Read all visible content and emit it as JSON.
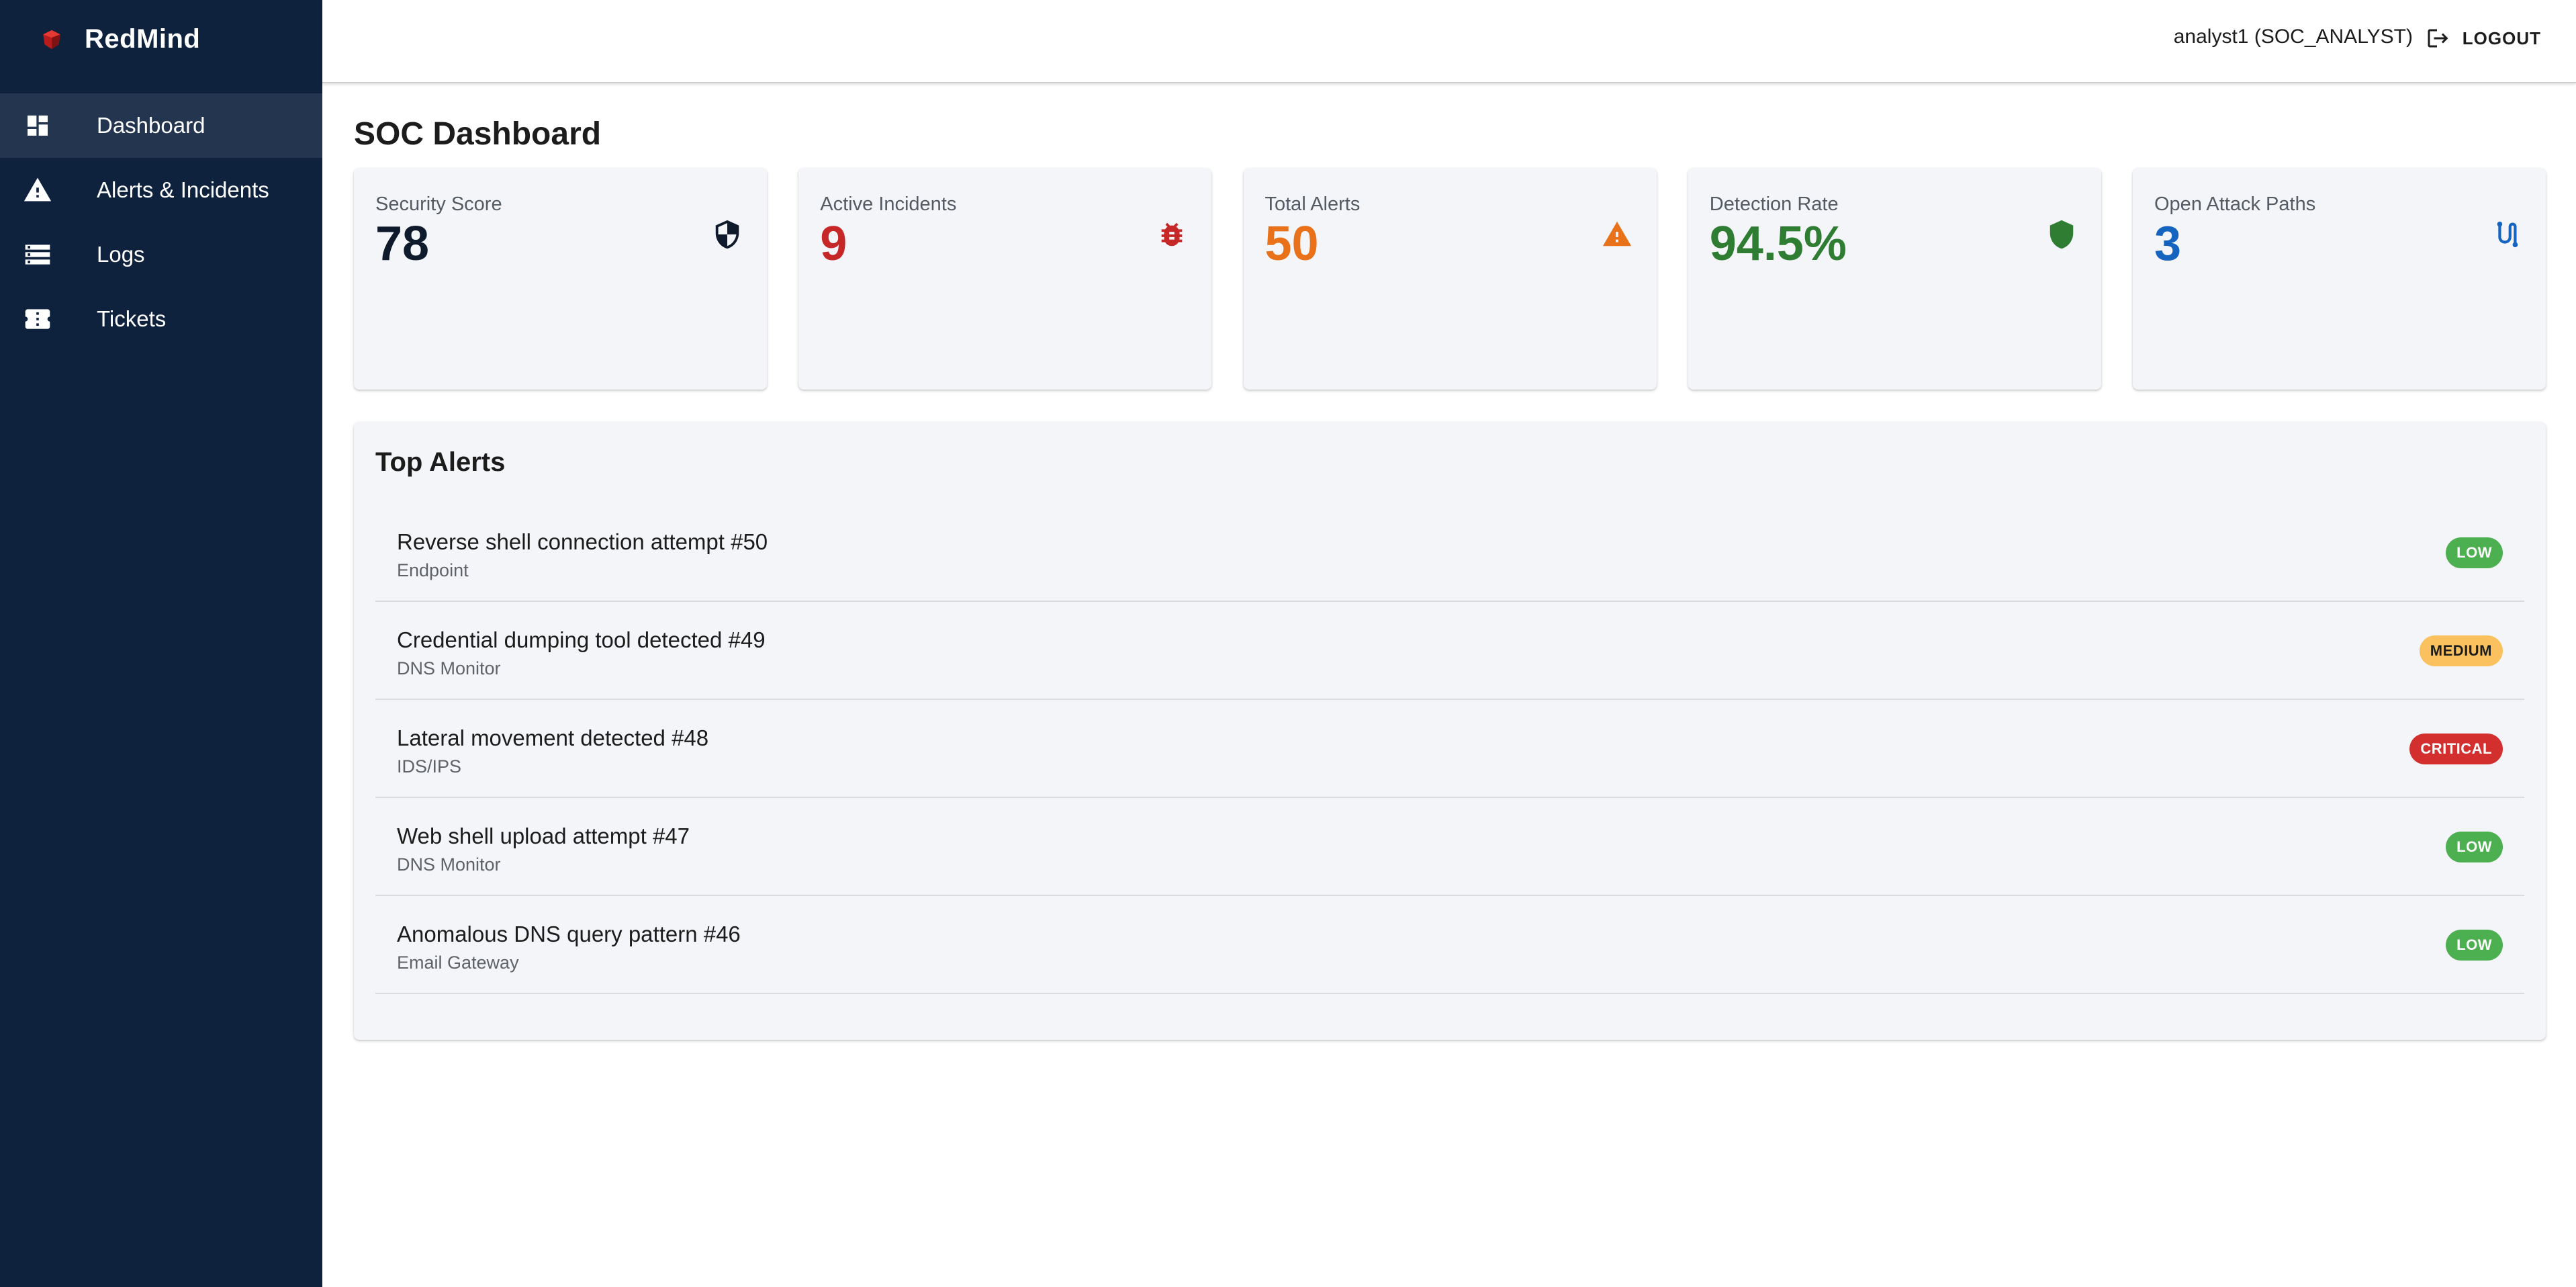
{
  "app": {
    "brand_name": "RedMind",
    "brand_color": "#c62828"
  },
  "sidebar": {
    "items": [
      {
        "label": "Dashboard",
        "icon": "dashboard-icon",
        "active": true
      },
      {
        "label": "Alerts & Incidents",
        "icon": "warning-icon",
        "active": false
      },
      {
        "label": "Logs",
        "icon": "list-icon",
        "active": false
      },
      {
        "label": "Tickets",
        "icon": "ticket-icon",
        "active": false
      }
    ]
  },
  "header": {
    "user": "analyst1 (SOC_ANALYST)",
    "logout_label": "LOGOUT",
    "logout_icon": "logout-icon"
  },
  "page": {
    "title": "SOC Dashboard"
  },
  "stats": [
    {
      "label": "Security Score",
      "value": "78",
      "color": "#0f1b2d",
      "icon": "shield-half-icon"
    },
    {
      "label": "Active Incidents",
      "value": "9",
      "color": "#c62828",
      "icon": "bug-icon"
    },
    {
      "label": "Total Alerts",
      "value": "50",
      "color": "#e8711a",
      "icon": "warning-icon"
    },
    {
      "label": "Detection Rate",
      "value": "94.5%",
      "color": "#2e7d32",
      "icon": "shield-icon"
    },
    {
      "label": "Open Attack Paths",
      "value": "3",
      "color": "#1565c0",
      "icon": "route-icon"
    }
  ],
  "top_alerts": {
    "title": "Top Alerts",
    "items": [
      {
        "title": "Reverse shell connection attempt #50",
        "source": "Endpoint",
        "severity": "LOW"
      },
      {
        "title": "Credential dumping tool detected #49",
        "source": "DNS Monitor",
        "severity": "MEDIUM"
      },
      {
        "title": "Lateral movement detected #48",
        "source": "IDS/IPS",
        "severity": "CRITICAL"
      },
      {
        "title": "Web shell upload attempt #47",
        "source": "DNS Monitor",
        "severity": "LOW"
      },
      {
        "title": "Anomalous DNS query pattern #46",
        "source": "Email Gateway",
        "severity": "LOW"
      }
    ]
  },
  "severity_colors": {
    "LOW": {
      "bg": "#4caf50",
      "fg": "#ffffff"
    },
    "MEDIUM": {
      "bg": "#fbc15e",
      "fg": "#1c1c1c"
    },
    "CRITICAL": {
      "bg": "#d32f2f",
      "fg": "#ffffff"
    }
  }
}
